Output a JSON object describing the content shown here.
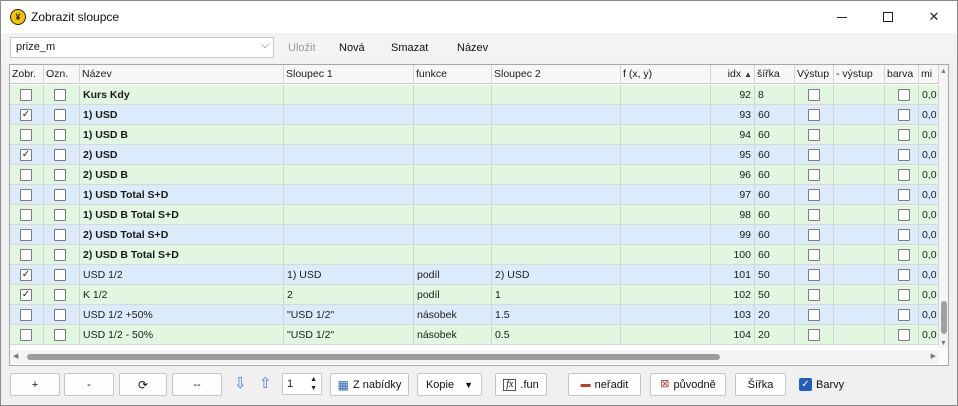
{
  "window": {
    "title": "Zobrazit sloupce",
    "minimize": "—",
    "maximize": "□",
    "close": "✕",
    "icon": "app-logo-icon"
  },
  "toolbar": {
    "combo_value": "prize_m",
    "save_label": "Uložit",
    "new_label": "Nová",
    "delete_label": "Smazat",
    "name_label": "Název"
  },
  "columns": [
    "Zobr.",
    "Ozn.",
    "Název",
    "Sloupec 1",
    "funkce",
    "Sloupec 2",
    "f (x, y)",
    "idx",
    "šířka",
    "Výstup",
    "- výstup",
    "barva",
    "mi"
  ],
  "sort_indicator": "▲",
  "rows": [
    {
      "zobr": false,
      "ozn": false,
      "nazev": "Kurs Kdy",
      "bold": true,
      "s1": "",
      "funkce": "",
      "s2": "",
      "fxy": "",
      "idx": "92",
      "sirka": "8",
      "mi": "0,0",
      "color": "green"
    },
    {
      "zobr": true,
      "ozn": false,
      "nazev": "1) USD",
      "bold": true,
      "s1": "",
      "funkce": "",
      "s2": "",
      "fxy": "",
      "idx": "93",
      "sirka": "60",
      "mi": "0,0",
      "color": "blue"
    },
    {
      "zobr": false,
      "ozn": false,
      "nazev": "1) USD B",
      "bold": true,
      "s1": "",
      "funkce": "",
      "s2": "",
      "fxy": "",
      "idx": "94",
      "sirka": "60",
      "mi": "0,0",
      "color": "green"
    },
    {
      "zobr": true,
      "ozn": false,
      "nazev": "2) USD",
      "bold": true,
      "s1": "",
      "funkce": "",
      "s2": "",
      "fxy": "",
      "idx": "95",
      "sirka": "60",
      "mi": "0,0",
      "color": "blue"
    },
    {
      "zobr": false,
      "ozn": false,
      "nazev": "2) USD B",
      "bold": true,
      "s1": "",
      "funkce": "",
      "s2": "",
      "fxy": "",
      "idx": "96",
      "sirka": "60",
      "mi": "0,0",
      "color": "green"
    },
    {
      "zobr": false,
      "ozn": false,
      "nazev": "1) USD Total S+D",
      "bold": true,
      "s1": "",
      "funkce": "",
      "s2": "",
      "fxy": "",
      "idx": "97",
      "sirka": "60",
      "mi": "0,0",
      "color": "blue"
    },
    {
      "zobr": false,
      "ozn": false,
      "nazev": "1) USD B Total S+D",
      "bold": true,
      "s1": "",
      "funkce": "",
      "s2": "",
      "fxy": "",
      "idx": "98",
      "sirka": "60",
      "mi": "0,0",
      "color": "green"
    },
    {
      "zobr": false,
      "ozn": false,
      "nazev": "2) USD Total S+D",
      "bold": true,
      "s1": "",
      "funkce": "",
      "s2": "",
      "fxy": "",
      "idx": "99",
      "sirka": "60",
      "mi": "0,0",
      "color": "blue"
    },
    {
      "zobr": false,
      "ozn": false,
      "nazev": "2) USD B Total S+D",
      "bold": true,
      "s1": "",
      "funkce": "",
      "s2": "",
      "fxy": "",
      "idx": "100",
      "sirka": "60",
      "mi": "0,0",
      "color": "green"
    },
    {
      "zobr": true,
      "ozn": false,
      "nazev": "USD 1/2",
      "bold": false,
      "s1": "1) USD",
      "funkce": "podíl",
      "s2": "2) USD",
      "fxy": "",
      "idx": "101",
      "sirka": "50",
      "mi": "0,0",
      "color": "blue"
    },
    {
      "zobr": true,
      "ozn": false,
      "nazev": "K 1/2",
      "bold": false,
      "s1": "2",
      "funkce": "podíl",
      "s2": "1",
      "fxy": "",
      "idx": "102",
      "sirka": "50",
      "mi": "0,0",
      "color": "green"
    },
    {
      "zobr": false,
      "ozn": false,
      "nazev": "USD 1/2 +50%",
      "bold": false,
      "s1": "\"USD 1/2\"",
      "funkce": "násobek",
      "s2": "1.5",
      "fxy": "",
      "idx": "103",
      "sirka": "20",
      "mi": "0,0",
      "color": "blue"
    },
    {
      "zobr": false,
      "ozn": false,
      "nazev": "USD 1/2 - 50%",
      "bold": false,
      "s1": "\"USD 1/2\"",
      "funkce": "násobek",
      "s2": "0.5",
      "fxy": "",
      "idx": "104",
      "sirka": "20",
      "mi": "0,0",
      "color": "green"
    }
  ],
  "colors": {
    "green_row": "#e1f7e0",
    "blue_row": "#dcebfb",
    "accent": "#1f5fbf",
    "arrow_blue": "#3f7fd6"
  },
  "bottom": {
    "plus_label": "+",
    "minus_label": "-",
    "refresh_icon": "refresh-icon",
    "dash_label": "--",
    "spinner_value": "1",
    "menu_label": "Z nabídky",
    "copy_label": "Kopie",
    "fun_label": ".fun",
    "unsort_label": "neřadit",
    "original_label": "původně",
    "width_label": "Šířka",
    "colors_label": "Barvy",
    "colors_checked": true
  }
}
